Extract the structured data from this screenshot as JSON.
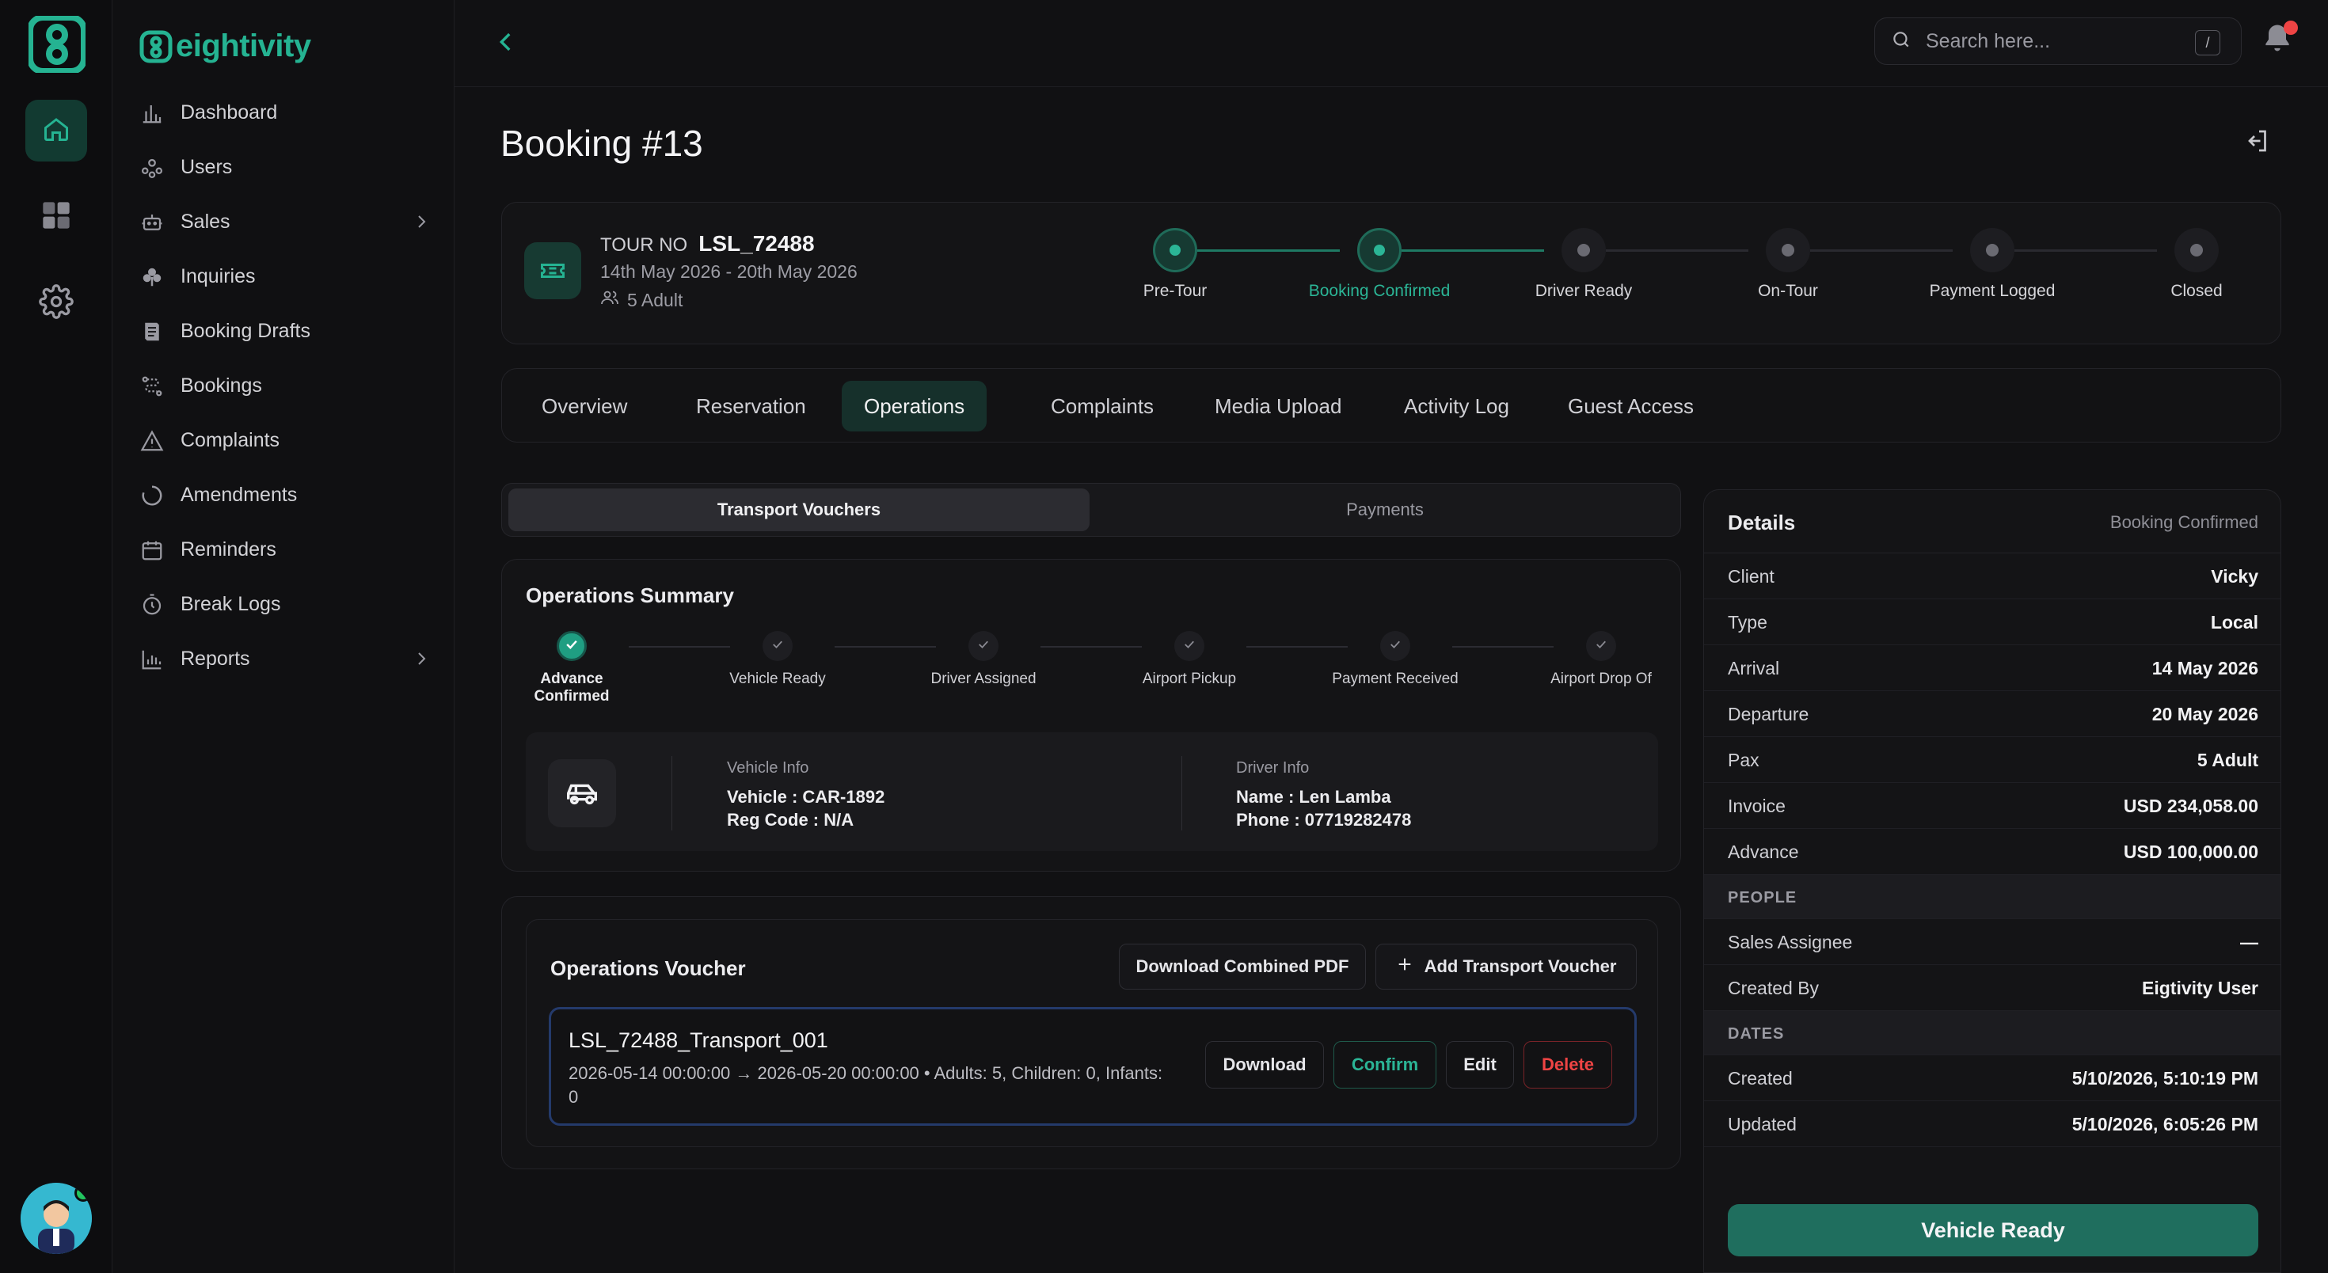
{
  "app": {
    "brand_name": "eightivity",
    "accent_color": "#25b392"
  },
  "rail": {
    "items": [
      {
        "icon": "home-icon",
        "active": true
      },
      {
        "icon": "grid-icon",
        "active": false
      },
      {
        "icon": "gear-icon",
        "active": false
      }
    ],
    "avatar": "user-avatar"
  },
  "nav": {
    "items": [
      {
        "label": "Dashboard",
        "icon": "bar-chart-icon"
      },
      {
        "label": "Users",
        "icon": "users-icon"
      },
      {
        "label": "Sales",
        "icon": "robot-icon",
        "has_submenu": true
      },
      {
        "label": "Inquiries",
        "icon": "club-icon"
      },
      {
        "label": "Booking Drafts",
        "icon": "book-icon"
      },
      {
        "label": "Bookings",
        "icon": "route-icon"
      },
      {
        "label": "Complaints",
        "icon": "warning-icon"
      },
      {
        "label": "Amendments",
        "icon": "spinner-icon"
      },
      {
        "label": "Reminders",
        "icon": "calendar-icon"
      },
      {
        "label": "Break Logs",
        "icon": "timer-icon"
      },
      {
        "label": "Reports",
        "icon": "report-icon",
        "has_submenu": true
      }
    ]
  },
  "topbar": {
    "search_placeholder": "Search here...",
    "search_shortcut": "/",
    "notification_dot_color": "#ef4444"
  },
  "page": {
    "title": "Booking #13"
  },
  "tour": {
    "label": "TOUR NO",
    "number": "LSL_72488",
    "dates": "14th May 2026 - 20th May 2026",
    "pax": "5 Adult",
    "steps": [
      {
        "label": "Pre-Tour",
        "state": "done"
      },
      {
        "label": "Booking Confirmed",
        "state": "current"
      },
      {
        "label": "Driver Ready",
        "state": "todo"
      },
      {
        "label": "On-Tour",
        "state": "todo"
      },
      {
        "label": "Payment Logged",
        "state": "todo"
      },
      {
        "label": "Closed",
        "state": "todo"
      }
    ]
  },
  "tabs": {
    "items": [
      "Overview",
      "Reservation",
      "Operations",
      "Complaints",
      "Media Upload",
      "Activity Log",
      "Guest Access"
    ],
    "active": "Operations"
  },
  "segment": {
    "items": [
      "Transport Vouchers",
      "Payments"
    ],
    "active": "Transport Vouchers"
  },
  "ops_summary": {
    "title": "Operations Summary",
    "steps": [
      {
        "label": "Advance Confirmed",
        "state": "done"
      },
      {
        "label": "Vehicle Ready",
        "state": "todo"
      },
      {
        "label": "Driver Assigned",
        "state": "todo"
      },
      {
        "label": "Airport Pickup",
        "state": "todo"
      },
      {
        "label": "Payment Received",
        "state": "todo"
      },
      {
        "label": "Airport Drop Of",
        "state": "todo"
      }
    ],
    "vehicle": {
      "caption": "Vehicle Info",
      "vehicle": "Vehicle : CAR-1892",
      "reg": "Reg Code : N/A"
    },
    "driver": {
      "caption": "Driver Info",
      "name": "Name : Len Lamba",
      "phone": "Phone : 07719282478"
    }
  },
  "voucher": {
    "title": "Operations Voucher",
    "download_combined": "Download Combined PDF",
    "add_transport": "Add Transport Voucher",
    "card": {
      "name": "LSL_72488_Transport_001",
      "meta": "2026-05-14 00:00:00 → 2026-05-20 00:00:00 • Adults: 5, Children: 0, Infants: 0",
      "download": "Download",
      "confirm": "Confirm",
      "edit": "Edit",
      "delete": "Delete"
    }
  },
  "details": {
    "title": "Details",
    "status": "Booking Confirmed",
    "rows": [
      {
        "key": "Client",
        "value": "Vicky"
      },
      {
        "key": "Type",
        "value": "Local"
      },
      {
        "key": "Arrival",
        "value": "14 May 2026"
      },
      {
        "key": "Departure",
        "value": "20 May 2026"
      },
      {
        "key": "Pax",
        "value": "5 Adult"
      },
      {
        "key": "Invoice",
        "value": "USD 234,058.00"
      },
      {
        "key": "Advance",
        "value": "USD 100,000.00"
      }
    ],
    "people_header": "PEOPLE",
    "people": [
      {
        "key": "Sales Assignee",
        "value": "—"
      },
      {
        "key": "Created By",
        "value": "Eigtivity User"
      }
    ],
    "dates_header": "DATES",
    "dates": [
      {
        "key": "Created",
        "value": "5/10/2026, 5:10:19 PM"
      },
      {
        "key": "Updated",
        "value": "5/10/2026, 6:05:26 PM"
      }
    ],
    "action": "Vehicle Ready"
  }
}
